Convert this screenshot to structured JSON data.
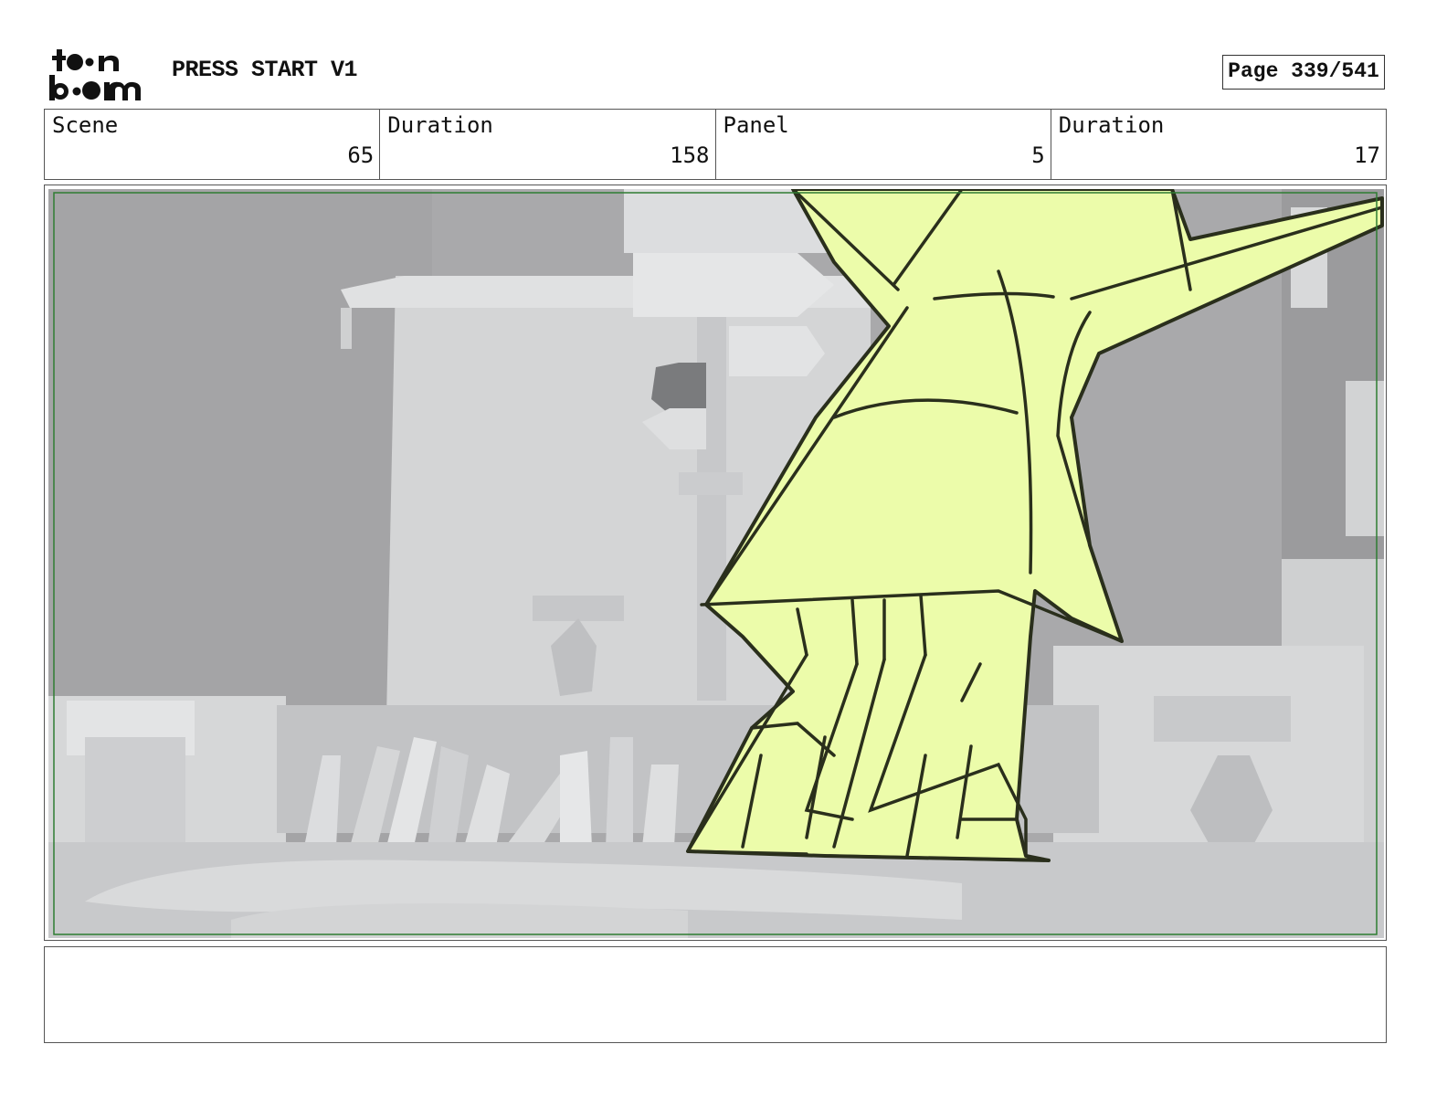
{
  "header": {
    "logo_text": "toon boom",
    "project_title": "PRESS START V1",
    "page_label": "Page 339/541"
  },
  "info": [
    {
      "label": "Scene",
      "value": "65"
    },
    {
      "label": "Duration",
      "value": "158"
    },
    {
      "label": "Panel",
      "value": "5"
    },
    {
      "label": "Duration",
      "value": "17"
    }
  ],
  "panel": {
    "safe_frame_color": "#2e7d32",
    "character_fill": "#ecfcaa",
    "line_color": "#2a2f1c"
  },
  "notes": {
    "text": ""
  }
}
